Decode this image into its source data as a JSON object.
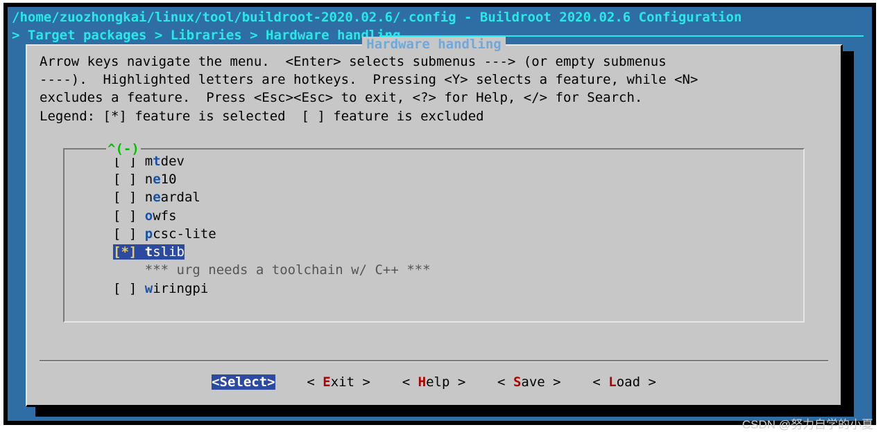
{
  "title": "/home/zuozhongkai/linux/tool/buildroot-2020.02.6/.config - Buildroot 2020.02.6 Configuration",
  "crumb_prefix": "> ",
  "crumb": "Target packages > Libraries > Hardware handling ",
  "dialog_title": "Hardware handling",
  "help_lines": [
    "Arrow keys navigate the menu.  <Enter> selects submenus ---> (or empty submenus",
    "----).  Highlighted letters are hotkeys.  Pressing <Y> selects a feature, while <N>",
    "excludes a feature.  Press <Esc><Esc> to exit, <?> for Help, </> for Search.",
    "Legend: [*] feature is selected  [ ] feature is excluded"
  ],
  "scroll_hint": "^(-)",
  "items": [
    {
      "mark": "[ ]",
      "pre": "m",
      "hot": "t",
      "post": "dev",
      "selected": false,
      "type": "opt"
    },
    {
      "mark": "[ ]",
      "pre": "n",
      "hot": "e",
      "post": "10",
      "selected": false,
      "type": "opt"
    },
    {
      "mark": "[ ]",
      "pre": "n",
      "hot": "e",
      "post": "ardal",
      "selected": false,
      "type": "opt"
    },
    {
      "mark": "[ ]",
      "pre": "",
      "hot": "o",
      "post": "wfs",
      "selected": false,
      "type": "opt"
    },
    {
      "mark": "[ ]",
      "pre": "",
      "hot": "p",
      "post": "csc-lite",
      "selected": false,
      "type": "opt"
    },
    {
      "mark": "[*]",
      "pre": "",
      "hot": "t",
      "post": "slib",
      "selected": true,
      "type": "opt"
    },
    {
      "text": "    *** urg needs a toolchain w/ C++ ***",
      "type": "comment"
    },
    {
      "mark": "[ ]",
      "pre": "",
      "hot": "w",
      "post": "iringpi",
      "selected": false,
      "type": "opt"
    }
  ],
  "buttons": [
    {
      "open": "<",
      "hot": "S",
      "rest": "elect",
      "close": ">",
      "selected": true
    },
    {
      "open": "< ",
      "hot": "E",
      "rest": "xit ",
      "close": ">",
      "selected": false
    },
    {
      "open": "< ",
      "hot": "H",
      "rest": "elp ",
      "close": ">",
      "selected": false
    },
    {
      "open": "< ",
      "hot": "S",
      "rest": "ave ",
      "close": ">",
      "selected": false
    },
    {
      "open": "< ",
      "hot": "L",
      "rest": "oad ",
      "close": ">",
      "selected": false
    }
  ],
  "button_gap": "    ",
  "watermark": "CSDN @努力自学的小夏"
}
